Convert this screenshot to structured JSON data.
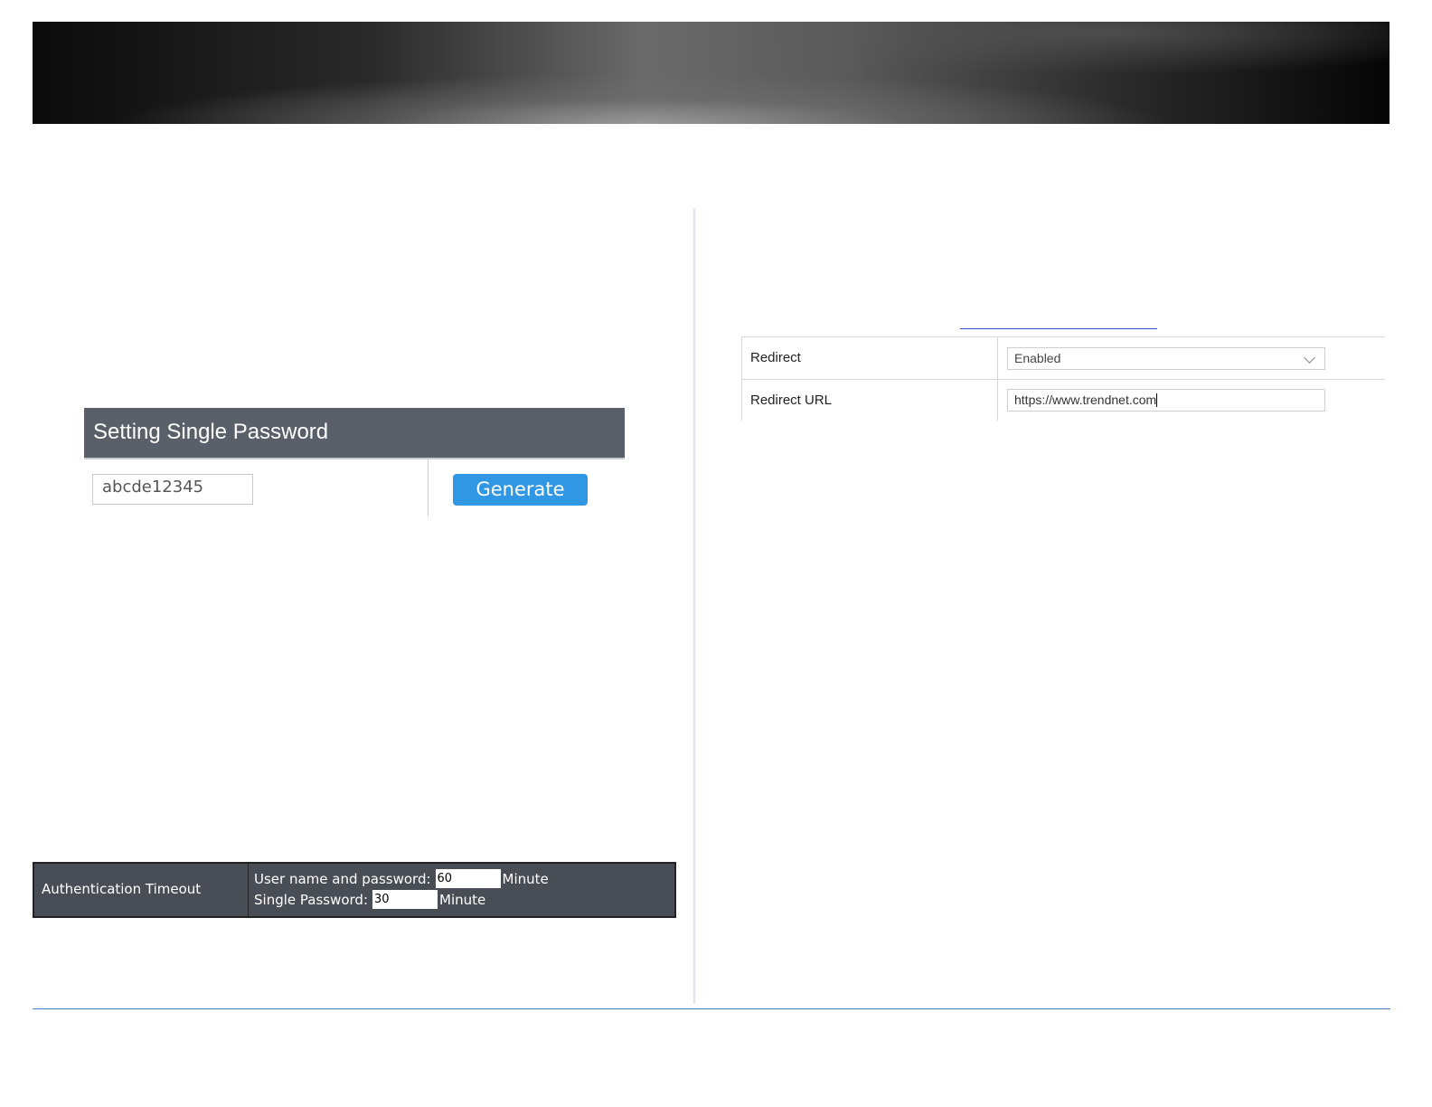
{
  "single_password": {
    "title": "Setting Single Password",
    "password_value": "abcde12345",
    "generate_label": "Generate"
  },
  "auth_timeout": {
    "label": "Authentication Timeout",
    "user_pw_label": "User name and password:",
    "user_pw_value": "60",
    "single_pw_label": "Single Password:",
    "single_pw_value": "30",
    "unit": "Minute"
  },
  "redirect": {
    "redirect_label": "Redirect",
    "redirect_value": "Enabled",
    "url_label": "Redirect URL",
    "url_value": "https://www.trendnet.com"
  },
  "colors": {
    "header_bg": "#5a6069",
    "button_blue": "#2f97e4",
    "auth_bg": "#494d55",
    "footer_line": "#4a86c5"
  }
}
